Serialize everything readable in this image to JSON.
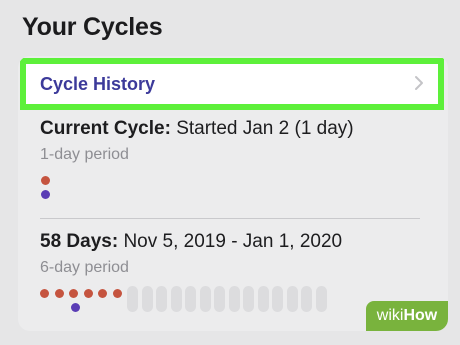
{
  "page": {
    "title": "Your Cycles"
  },
  "cycle_history": {
    "label": "Cycle History",
    "chevron_icon": "chevron-right-icon",
    "highlight_color": "#5df03a"
  },
  "current_cycle": {
    "title_bold": "Current Cycle:",
    "title_rest": " Started Jan 2 (1 day)",
    "period": "1-day period"
  },
  "past_cycle": {
    "title_bold": "58 Days:",
    "title_rest": " Nov 5, 2019 - Jan 1, 2020",
    "period": "6-day period"
  },
  "colors": {
    "period_dot": "#c5543f",
    "fertile_dot": "#5a3db5",
    "accent": "#3c3a9a"
  },
  "watermark": {
    "wiki": "wiki",
    "how": "How"
  }
}
